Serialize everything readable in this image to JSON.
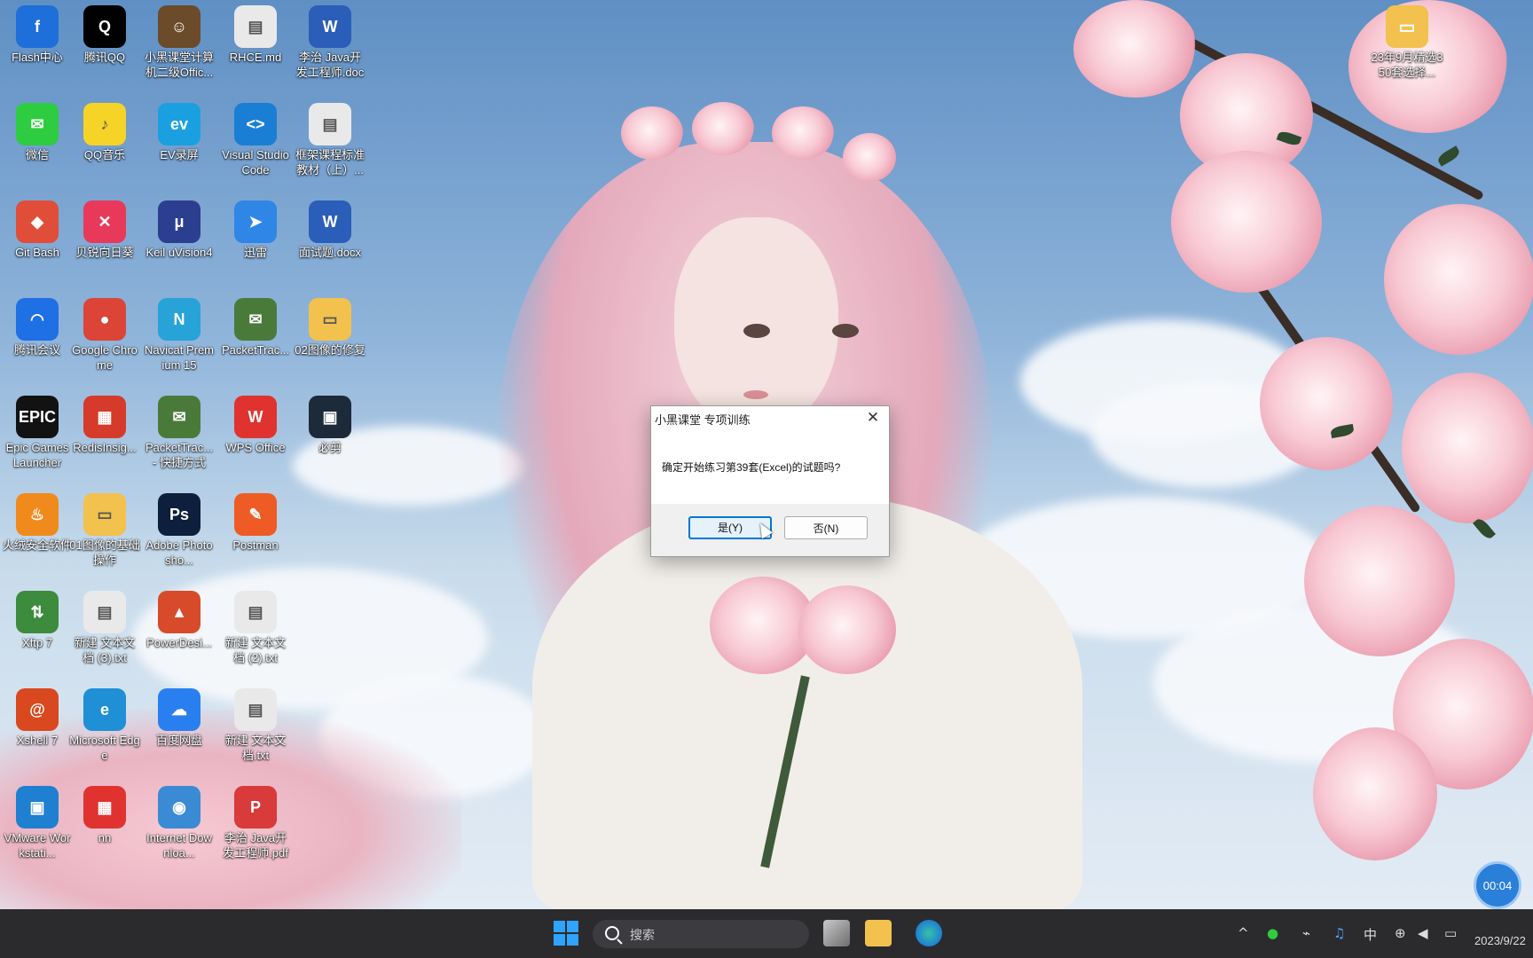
{
  "desktop": {
    "icons": [
      {
        "label": "Flash中心",
        "color": "#1e6fd9",
        "glyph": "f"
      },
      {
        "label": "腾讯QQ",
        "color": "#000000",
        "glyph": "Q"
      },
      {
        "label": "小黑课堂计算机二级Offic...",
        "color": "#6b4b2a",
        "glyph": "☺"
      },
      {
        "label": "RHCE.md",
        "color": "#e9e9e9",
        "glyph": "▤"
      },
      {
        "label": "李治 Java开发工程师.doc",
        "color": "#2b5eb8",
        "glyph": "W"
      },
      {
        "label": "微信",
        "color": "#2ecc40",
        "glyph": "✉"
      },
      {
        "label": "QQ音乐",
        "color": "#f5d327",
        "glyph": "♪"
      },
      {
        "label": "EV录屏",
        "color": "#1aa0e0",
        "glyph": "ev"
      },
      {
        "label": "Visual Studio Code",
        "color": "#1a7fd4",
        "glyph": "<>"
      },
      {
        "label": "框架课程标准教材（上）...",
        "color": "#e9e9e9",
        "glyph": "▤"
      },
      {
        "label": "Git Bash",
        "color": "#e04e39",
        "glyph": "◆"
      },
      {
        "label": "贝锐向日葵",
        "color": "#e8395b",
        "glyph": "✕"
      },
      {
        "label": "Keil uVision4",
        "color": "#2c3e90",
        "glyph": "μ"
      },
      {
        "label": "迅雷",
        "color": "#2f86e6",
        "glyph": "➤"
      },
      {
        "label": "面试题.docx",
        "color": "#2b5eb8",
        "glyph": "W"
      },
      {
        "label": "腾讯会议",
        "color": "#1f6fe5",
        "glyph": "◠"
      },
      {
        "label": "Google Chrome",
        "color": "#db4437",
        "glyph": "●"
      },
      {
        "label": "Navicat Premium 15",
        "color": "#27a3d8",
        "glyph": "N"
      },
      {
        "label": "PacketTrac...",
        "color": "#4a7a3a",
        "glyph": "✉"
      },
      {
        "label": "02图像的修复",
        "color": "#f2c14e",
        "glyph": "▭"
      },
      {
        "label": "Epic Games Launcher",
        "color": "#121212",
        "glyph": "EPIC"
      },
      {
        "label": "RedisInsig...",
        "color": "#d63a2a",
        "glyph": "▦"
      },
      {
        "label": "PacketTrac... - 快捷方式",
        "color": "#4a7a3a",
        "glyph": "✉"
      },
      {
        "label": "WPS Office",
        "color": "#e0332f",
        "glyph": "W"
      },
      {
        "label": "必剪",
        "color": "#1d2a3a",
        "glyph": "▣"
      },
      {
        "label": "火绒安全软件",
        "color": "#f08a1c",
        "glyph": "♨"
      },
      {
        "label": "01图像的基础操作",
        "color": "#f2c14e",
        "glyph": "▭"
      },
      {
        "label": "Adobe Photosho...",
        "color": "#0d1f3d",
        "glyph": "Ps"
      },
      {
        "label": "Postman",
        "color": "#ef5b25",
        "glyph": "✎"
      },
      {
        "label": "",
        "color": "",
        "glyph": ""
      },
      {
        "label": "Xftp 7",
        "color": "#3d8b3d",
        "glyph": "⇅"
      },
      {
        "label": "新建 文本文档 (3).txt",
        "color": "#e9e9e9",
        "glyph": "▤"
      },
      {
        "label": "PowerDesi...",
        "color": "#d84b2a",
        "glyph": "▲"
      },
      {
        "label": "新建 文本文档 (2).txt",
        "color": "#e9e9e9",
        "glyph": "▤"
      },
      {
        "label": "",
        "color": "",
        "glyph": ""
      },
      {
        "label": "Xshell 7",
        "color": "#d9481f",
        "glyph": "@"
      },
      {
        "label": "Microsoft Edge",
        "color": "#1f8fd6",
        "glyph": "e"
      },
      {
        "label": "百度网盘",
        "color": "#2a7ff0",
        "glyph": "☁"
      },
      {
        "label": "新建 文本文档.txt",
        "color": "#e9e9e9",
        "glyph": "▤"
      },
      {
        "label": "",
        "color": "",
        "glyph": ""
      },
      {
        "label": "VMware Workstati...",
        "color": "#1f7fd0",
        "glyph": "▣"
      },
      {
        "label": "nn",
        "color": "#e0332f",
        "glyph": "▦"
      },
      {
        "label": "Internet Downloa...",
        "color": "#3a8ad4",
        "glyph": "◉"
      },
      {
        "label": "李治 Java开发工程师.pdf",
        "color": "#d93a3a",
        "glyph": "P"
      }
    ],
    "top_right_icon": {
      "label": "23年9月精选350套选择...",
      "color": "#f2c14e",
      "glyph": "▭"
    }
  },
  "dialog": {
    "title": "小黑课堂 专项训练",
    "close_label": "✕",
    "message": "确定开始练习第39套(Excel)的试题吗?",
    "yes_label": "是(Y)",
    "no_label": "否(N)"
  },
  "timer": {
    "value": "00:04"
  },
  "taskbar": {
    "search_placeholder": "搜索",
    "tray": {
      "chevron": "^",
      "ime": "中",
      "clock": "2023/9/22"
    }
  }
}
